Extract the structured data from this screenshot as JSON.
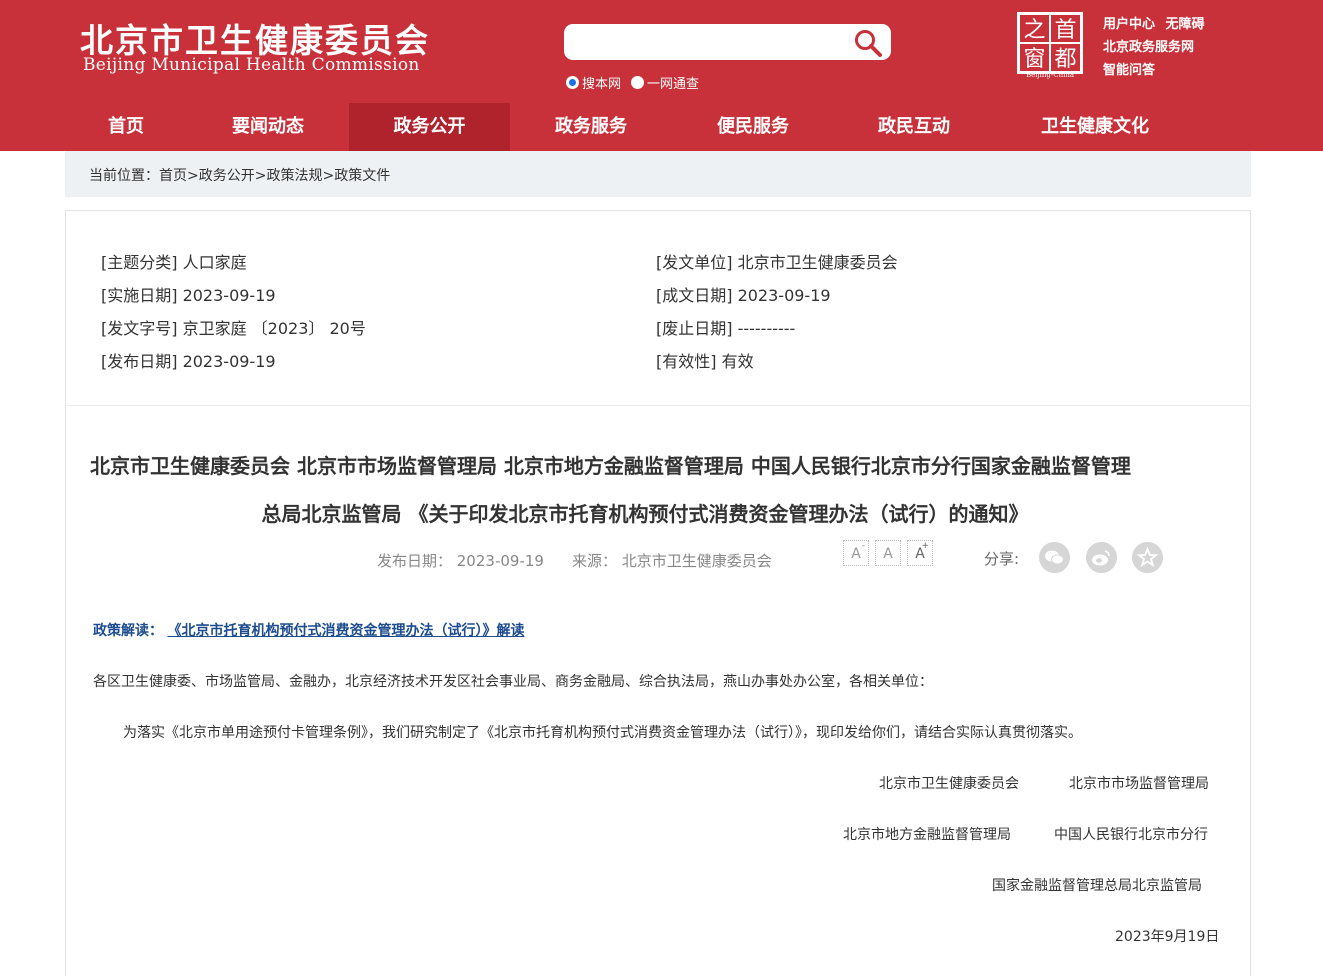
{
  "header": {
    "logo_cn": "北京市卫生健康委员会",
    "logo_en": "Beijing Municipal Health Commission",
    "search": {
      "placeholder": "",
      "options": [
        "搜本网",
        "一网通查"
      ]
    },
    "seal": {
      "chars": [
        "之",
        "首",
        "窗",
        "都"
      ],
      "caption": "Beijing-China"
    },
    "quick_links": [
      "用户中心",
      "无障碍",
      "北京政务服务网",
      "智能问答"
    ]
  },
  "nav": {
    "items": [
      "首页",
      "要闻动态",
      "政务公开",
      "政务服务",
      "便民服务",
      "政民互动",
      "卫生健康文化"
    ]
  },
  "breadcrumb": {
    "prefix": "当前位置：",
    "items": [
      "首页",
      "政务公开",
      "政策法规",
      "政策文件"
    ],
    "sep": ">"
  },
  "meta": {
    "topic": "[主题分类] 人口家庭",
    "issuer": "[发文单位] 北京市卫生健康委员会",
    "effective_date": "[实施日期] 2023-09-19",
    "created_date": "[成文日期] 2023-09-19",
    "doc_number": "[发文字号] 京卫家庭 〔2023〕 20号",
    "abolish_date": "[废止日期] ----------",
    "publish_date": "[发布日期] 2023-09-19",
    "validity": "[有效性] 有效"
  },
  "article": {
    "title_line1": "北京市卫生健康委员会 北京市市场监督管理局 北京市地方金融监督管理局 中国人民银行北京市分行国家金融监督管理",
    "title_line2": "总局北京监管局 《关于印发北京市托育机构预付式消费资金管理办法（试行）的通知》",
    "pub_date": "发布日期： 2023-09-19",
    "source": "来源： 北京市卫生健康委员会",
    "share_label": "分享:",
    "interp_label": "政策解读：",
    "interp_link": "《北京市托育机构预付式消费资金管理办法（试行）》解读",
    "salutation": "各区卫生健康委、市场监管局、金融办，北京经济技术开发区社会事业局、商务金融局、综合执法局，燕山办事处办公室，各相关单位：",
    "body": "为落实《北京市单用途预付卡管理条例》，我们研究制定了《北京市托育机构预付式消费资金管理办法（试行）》，现印发给你们，请结合实际认真贯彻落实。",
    "signatories": [
      "北京市卫生健康委员会",
      "北京市市场监督管理局",
      "北京市地方金融监督管理局",
      "中国人民银行北京市分行",
      "国家金融监督管理总局北京监管局"
    ],
    "sign_date": "2023年9月19日"
  },
  "icons": [
    "search-icon",
    "font-decrease-icon",
    "font-reset-icon",
    "font-increase-icon",
    "wechat-icon",
    "weibo-icon",
    "favorite-icon"
  ],
  "colors": {
    "brand_red": "#c8303a",
    "nav_active": "#b0232d",
    "link_blue": "#1d4c8f",
    "breadcrumb_bg": "#eef1f4"
  }
}
